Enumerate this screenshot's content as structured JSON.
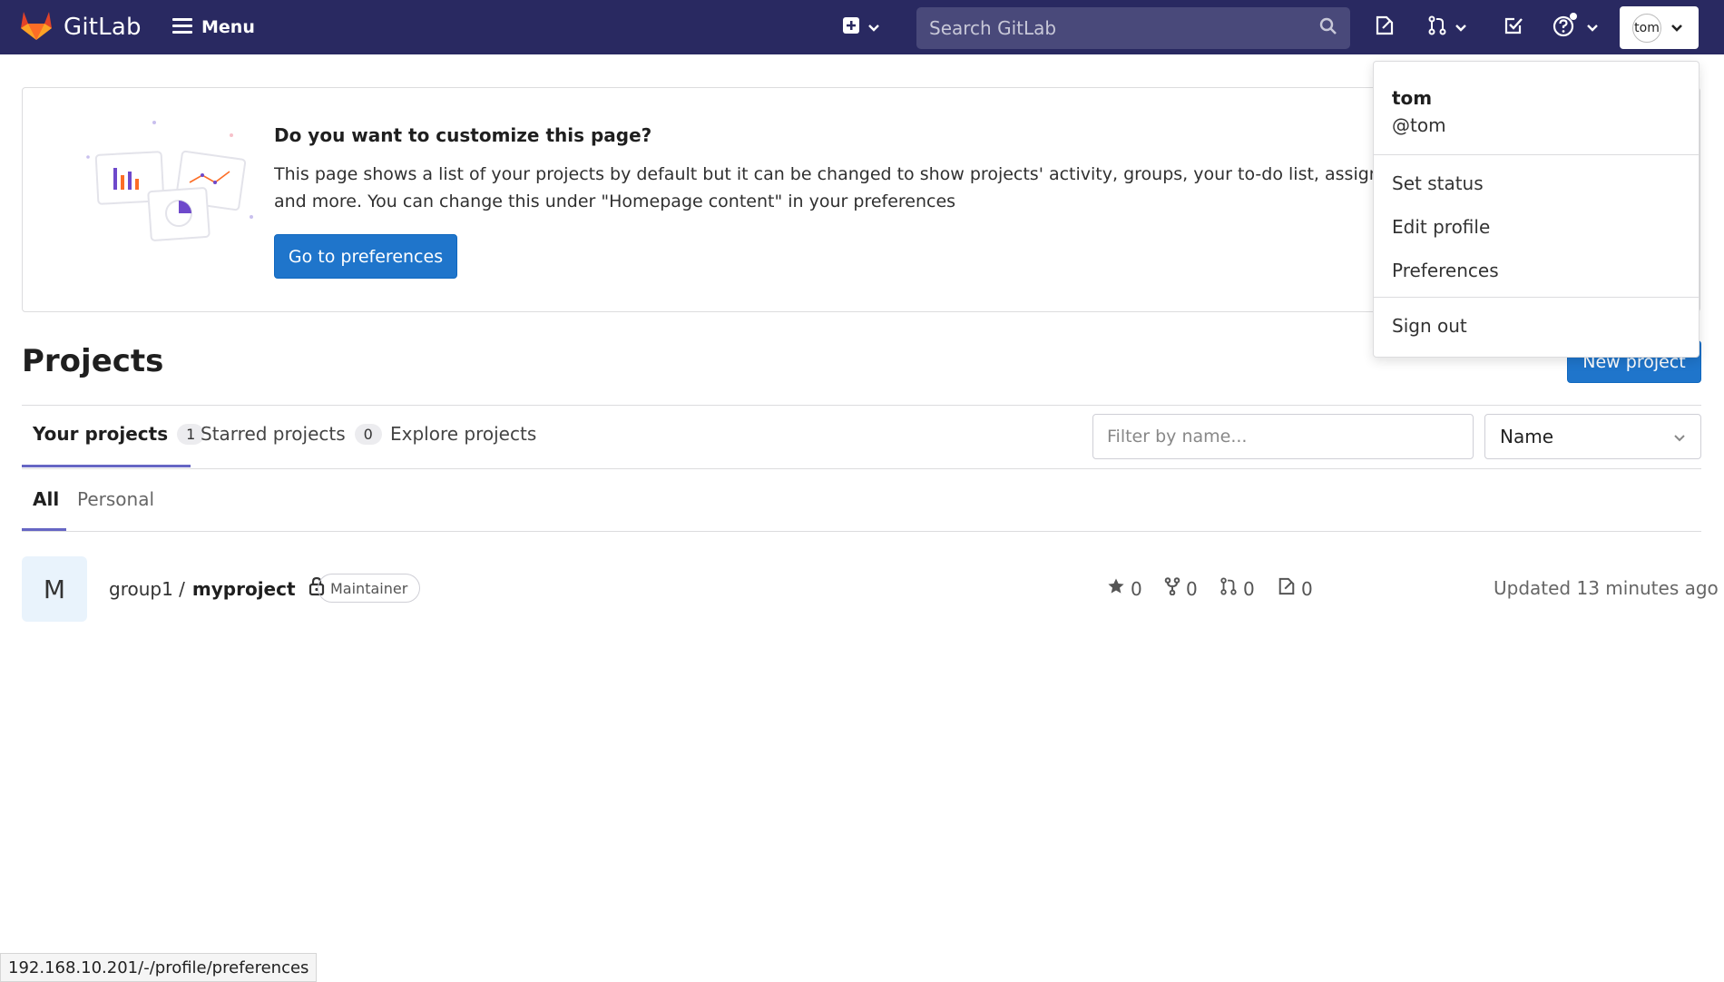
{
  "navbar": {
    "brand": "GitLab",
    "menu_label": "Menu",
    "search_placeholder": "Search GitLab",
    "avatar_text": "tom"
  },
  "banner": {
    "title": "Do you want to customize this page?",
    "text_line1": "This page shows a list of your projects by default but it can be changed to show projects' activity, groups, your to-do list, assigned i",
    "text_line2": "and more. You can change this under \"Homepage content\" in your preferences",
    "button_label": "Go to preferences"
  },
  "page": {
    "title": "Projects",
    "new_project_label": "New project"
  },
  "tabs": [
    {
      "label": "Your projects",
      "count": "1"
    },
    {
      "label": "Starred projects",
      "count": "0"
    },
    {
      "label": "Explore projects"
    }
  ],
  "filter": {
    "placeholder": "Filter by name...",
    "sort_value": "Name"
  },
  "subtabs": [
    {
      "label": "All"
    },
    {
      "label": "Personal"
    }
  ],
  "project": {
    "avatar_letter": "M",
    "namespace": "group1 /",
    "name": "myproject",
    "role": "Maintainer",
    "stars": "0",
    "forks": "0",
    "merge_requests": "0",
    "issues": "0",
    "updated": "Updated 13 minutes ago"
  },
  "user_dropdown": {
    "name": "tom",
    "handle": "@tom",
    "items": [
      "Set status",
      "Edit profile",
      "Preferences"
    ],
    "sign_out": "Sign out"
  },
  "statusbar": {
    "url": "192.168.10.201/-/profile/preferences"
  },
  "colors": {
    "navbar": "#292961",
    "primary": "#1f75cb",
    "tab_active": "#6666c4"
  }
}
